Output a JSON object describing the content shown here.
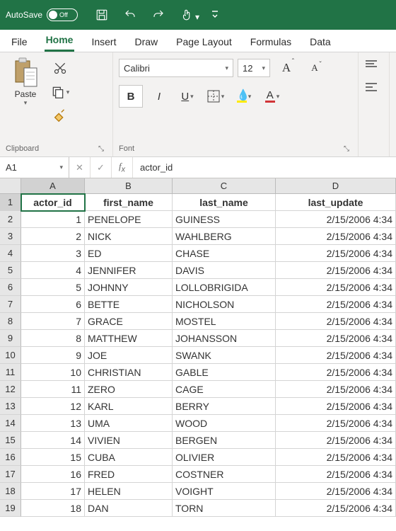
{
  "titlebar": {
    "autosave_label": "AutoSave",
    "autosave_state": "Off"
  },
  "tabs": [
    "File",
    "Home",
    "Insert",
    "Draw",
    "Page Layout",
    "Formulas",
    "Data"
  ],
  "active_tab": "Home",
  "ribbon": {
    "clipboard": {
      "label": "Clipboard",
      "paste": "Paste"
    },
    "font": {
      "label": "Font",
      "name": "Calibri",
      "size": "12",
      "bold": "B",
      "italic": "I",
      "underline": "U",
      "fill": "A",
      "color": "A"
    }
  },
  "namebox": "A1",
  "formula": "actor_id",
  "columns": [
    "A",
    "B",
    "C",
    "D"
  ],
  "col_widths": [
    "cA",
    "cB",
    "cC",
    "cD"
  ],
  "headers": [
    "actor_id",
    "first_name",
    "last_name",
    "last_update"
  ],
  "rows": [
    {
      "id": "1",
      "first": "PENELOPE",
      "last": "GUINESS",
      "upd": "2/15/2006 4:34"
    },
    {
      "id": "2",
      "first": "NICK",
      "last": "WAHLBERG",
      "upd": "2/15/2006 4:34"
    },
    {
      "id": "3",
      "first": "ED",
      "last": "CHASE",
      "upd": "2/15/2006 4:34"
    },
    {
      "id": "4",
      "first": "JENNIFER",
      "last": "DAVIS",
      "upd": "2/15/2006 4:34"
    },
    {
      "id": "5",
      "first": "JOHNNY",
      "last": "LOLLOBRIGIDA",
      "upd": "2/15/2006 4:34"
    },
    {
      "id": "6",
      "first": "BETTE",
      "last": "NICHOLSON",
      "upd": "2/15/2006 4:34"
    },
    {
      "id": "7",
      "first": "GRACE",
      "last": "MOSTEL",
      "upd": "2/15/2006 4:34"
    },
    {
      "id": "8",
      "first": "MATTHEW",
      "last": "JOHANSSON",
      "upd": "2/15/2006 4:34"
    },
    {
      "id": "9",
      "first": "JOE",
      "last": "SWANK",
      "upd": "2/15/2006 4:34"
    },
    {
      "id": "10",
      "first": "CHRISTIAN",
      "last": "GABLE",
      "upd": "2/15/2006 4:34"
    },
    {
      "id": "11",
      "first": "ZERO",
      "last": "CAGE",
      "upd": "2/15/2006 4:34"
    },
    {
      "id": "12",
      "first": "KARL",
      "last": "BERRY",
      "upd": "2/15/2006 4:34"
    },
    {
      "id": "13",
      "first": "UMA",
      "last": "WOOD",
      "upd": "2/15/2006 4:34"
    },
    {
      "id": "14",
      "first": "VIVIEN",
      "last": "BERGEN",
      "upd": "2/15/2006 4:34"
    },
    {
      "id": "15",
      "first": "CUBA",
      "last": "OLIVIER",
      "upd": "2/15/2006 4:34"
    },
    {
      "id": "16",
      "first": "FRED",
      "last": "COSTNER",
      "upd": "2/15/2006 4:34"
    },
    {
      "id": "17",
      "first": "HELEN",
      "last": "VOIGHT",
      "upd": "2/15/2006 4:34"
    },
    {
      "id": "18",
      "first": "DAN",
      "last": "TORN",
      "upd": "2/15/2006 4:34"
    }
  ]
}
